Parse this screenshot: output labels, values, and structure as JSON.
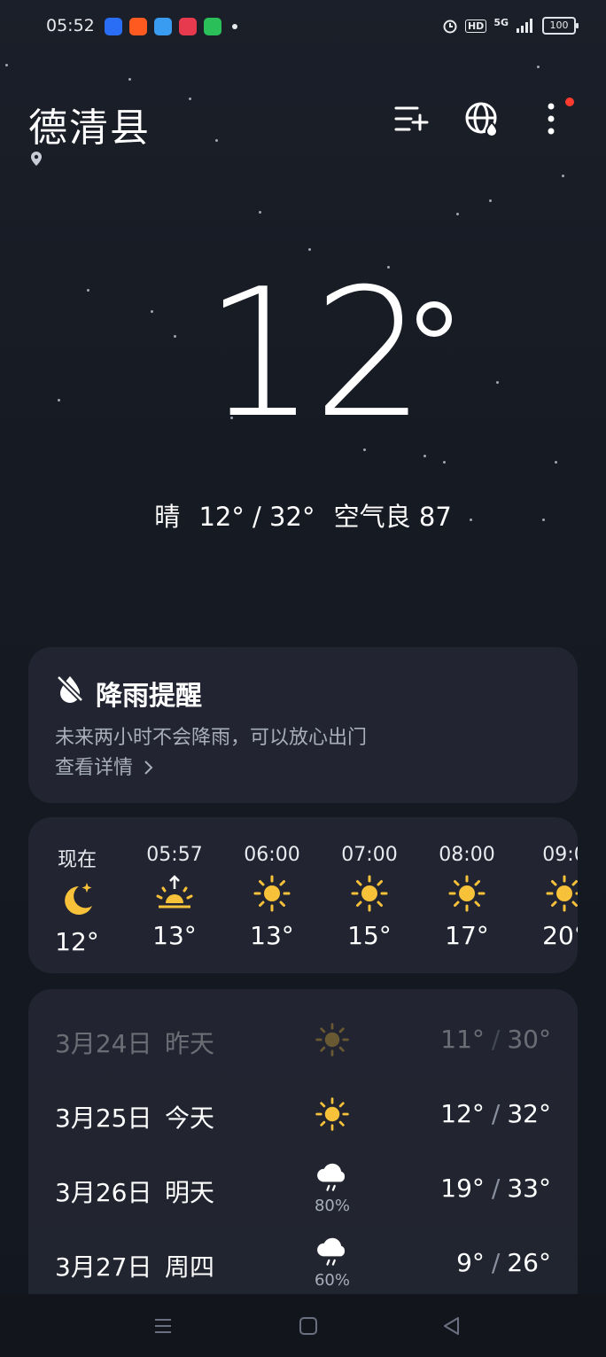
{
  "status_bar": {
    "time": "05:52",
    "battery": "100",
    "network": "5G",
    "hd": "HD"
  },
  "header": {
    "city": "德清县",
    "icons": [
      "location-pin-icon",
      "add-city-icon",
      "globe-weather-icon",
      "more-menu-icon"
    ]
  },
  "current": {
    "temperature": "12",
    "summary": {
      "condition": "晴",
      "range": "12° / 32°",
      "aqi": "空气良 87"
    }
  },
  "rain_alert": {
    "title": "降雨提醒",
    "description": "未来两小时不会降雨，可以放心出门",
    "link": "查看详情"
  },
  "hourly": [
    {
      "time": "现在",
      "temp": "12°",
      "icon": "moon-star-icon"
    },
    {
      "time": "05:57",
      "temp": "13°",
      "icon": "sunrise-icon"
    },
    {
      "time": "06:00",
      "temp": "13°",
      "icon": "sun-icon"
    },
    {
      "time": "07:00",
      "temp": "15°",
      "icon": "sun-icon"
    },
    {
      "time": "08:00",
      "temp": "17°",
      "icon": "sun-icon"
    },
    {
      "time": "09:0",
      "temp": "20°",
      "icon": "sun-icon"
    }
  ],
  "daily": [
    {
      "date": "3月24日",
      "day": "昨天",
      "low": "11°",
      "high": "30°",
      "icon": "sun-icon",
      "precip": ""
    },
    {
      "date": "3月25日",
      "day": "今天",
      "low": "12°",
      "high": "32°",
      "icon": "sun-icon",
      "precip": ""
    },
    {
      "date": "3月26日",
      "day": "明天",
      "low": "19°",
      "high": "33°",
      "icon": "cloud-rain-icon",
      "precip": "80%"
    },
    {
      "date": "3月27日",
      "day": "周四",
      "low": "9°",
      "high": "26°",
      "icon": "cloud-rain-icon",
      "precip": "60%"
    }
  ],
  "colors": {
    "sun": "#f7c23a",
    "background": "#161a22",
    "card": "#242834",
    "alert_dot": "#ff3b30"
  }
}
